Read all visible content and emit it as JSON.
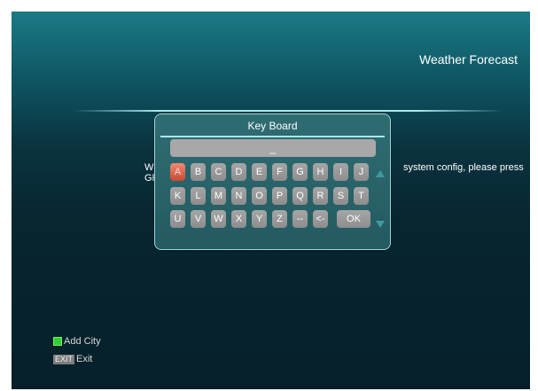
{
  "header": {
    "title": "Weather Forecast"
  },
  "background_message": {
    "left_line1": "W",
    "left_line2": "GF",
    "right_line1": "system config, please press"
  },
  "keyboard": {
    "title": "Key Board",
    "input_value": "_",
    "rows": [
      [
        "A",
        "B",
        "C",
        "D",
        "E",
        "F",
        "G",
        "H",
        "I",
        "J"
      ],
      [
        "K",
        "L",
        "M",
        "N",
        "O",
        "P",
        "Q",
        "R",
        "S",
        "T"
      ],
      [
        "U",
        "V",
        "W",
        "X",
        "Y",
        "Z",
        "--",
        "<-",
        "OK"
      ]
    ],
    "selected_key": "A"
  },
  "footer": {
    "green_label": "Add City",
    "exit_badge": "EXIT",
    "exit_label": "Exit"
  },
  "colors": {
    "accent_line": "#a8e8ee",
    "key_normal": "#9a9a9a",
    "key_selected": "#d85a42",
    "green_button": "#2fcf2f"
  }
}
